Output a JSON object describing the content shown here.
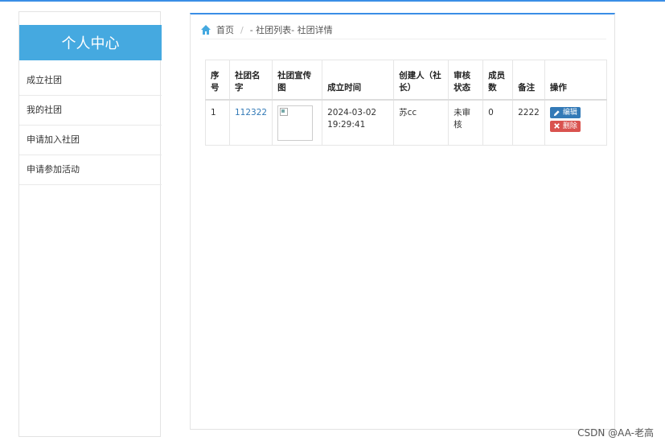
{
  "sidebar": {
    "title": "个人中心",
    "items": [
      {
        "label": "成立社团"
      },
      {
        "label": "我的社团"
      },
      {
        "label": "申请加入社团"
      },
      {
        "label": "申请参加活动"
      }
    ]
  },
  "breadcrumb": {
    "home": "首页",
    "separator": "/",
    "current": "- 社团列表- 社团详情"
  },
  "table": {
    "headers": {
      "index": "序号",
      "club_name": "社团名字",
      "poster": "社团宣传图",
      "created_time": "成立时间",
      "creator": "创建人（社长）",
      "review_status": "审核状态",
      "member_count": "成员数",
      "remark": "备注",
      "actions": "操作"
    },
    "rows": [
      {
        "index": "1",
        "club_name": "112322",
        "created_date": "2024-03-02",
        "created_clock": "19:29:41",
        "creator": "苏cc",
        "review_status": "未审核",
        "member_count": "0",
        "remark": "2222",
        "edit_label": "编辑",
        "delete_label": "删除"
      }
    ]
  },
  "watermark": "CSDN @AA-老高",
  "colors": {
    "accent": "#45a9e0",
    "link": "#337ab7",
    "edit": "#337ab7",
    "delete": "#d9534f"
  }
}
